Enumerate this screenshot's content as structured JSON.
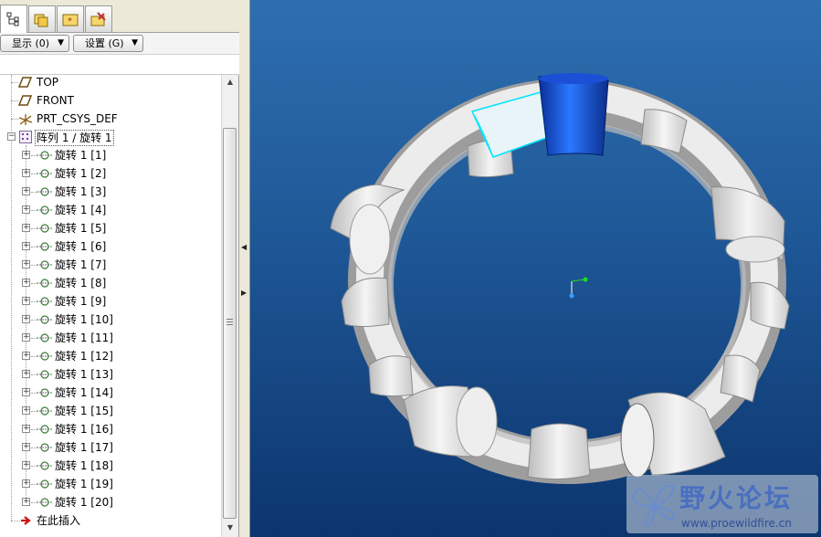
{
  "left_panel": {
    "tabs": [
      {
        "icon": "model-tree-icon",
        "active": true
      },
      {
        "icon": "folder-browser-icon",
        "active": false
      },
      {
        "icon": "favorites-icon",
        "active": false
      },
      {
        "icon": "connections-icon",
        "active": false
      }
    ],
    "display_button": "显示 (0)",
    "settings_button": "设置 (G)",
    "tree": {
      "top_plane": "TOP",
      "front_plane": "FRONT",
      "csys": "PRT_CSYS_DEF",
      "pattern": "阵列 1 / 旋转 1",
      "pattern_items": [
        "旋转 1 [1]",
        "旋转 1 [2]",
        "旋转 1 [3]",
        "旋转 1 [4]",
        "旋转 1 [5]",
        "旋转 1 [6]",
        "旋转 1 [7]",
        "旋转 1 [8]",
        "旋转 1 [9]",
        "旋转 1 [10]",
        "旋转 1 [11]",
        "旋转 1 [12]",
        "旋转 1 [13]",
        "旋转 1 [14]",
        "旋转 1 [15]",
        "旋转 1 [16]",
        "旋转 1 [17]",
        "旋转 1 [18]",
        "旋转 1 [19]",
        "旋转 1 [20]"
      ],
      "insert_here": "在此插入"
    }
  },
  "viewport": {
    "background_top": "#2e6fb0",
    "background_bottom": "#0c356e",
    "ring_color": "#e6e6e6",
    "selected_color": "#1c56d6",
    "highlight_color": "#00e5ff"
  },
  "watermark": {
    "title": "野火论坛",
    "url": "www.proewildfire.cn"
  }
}
